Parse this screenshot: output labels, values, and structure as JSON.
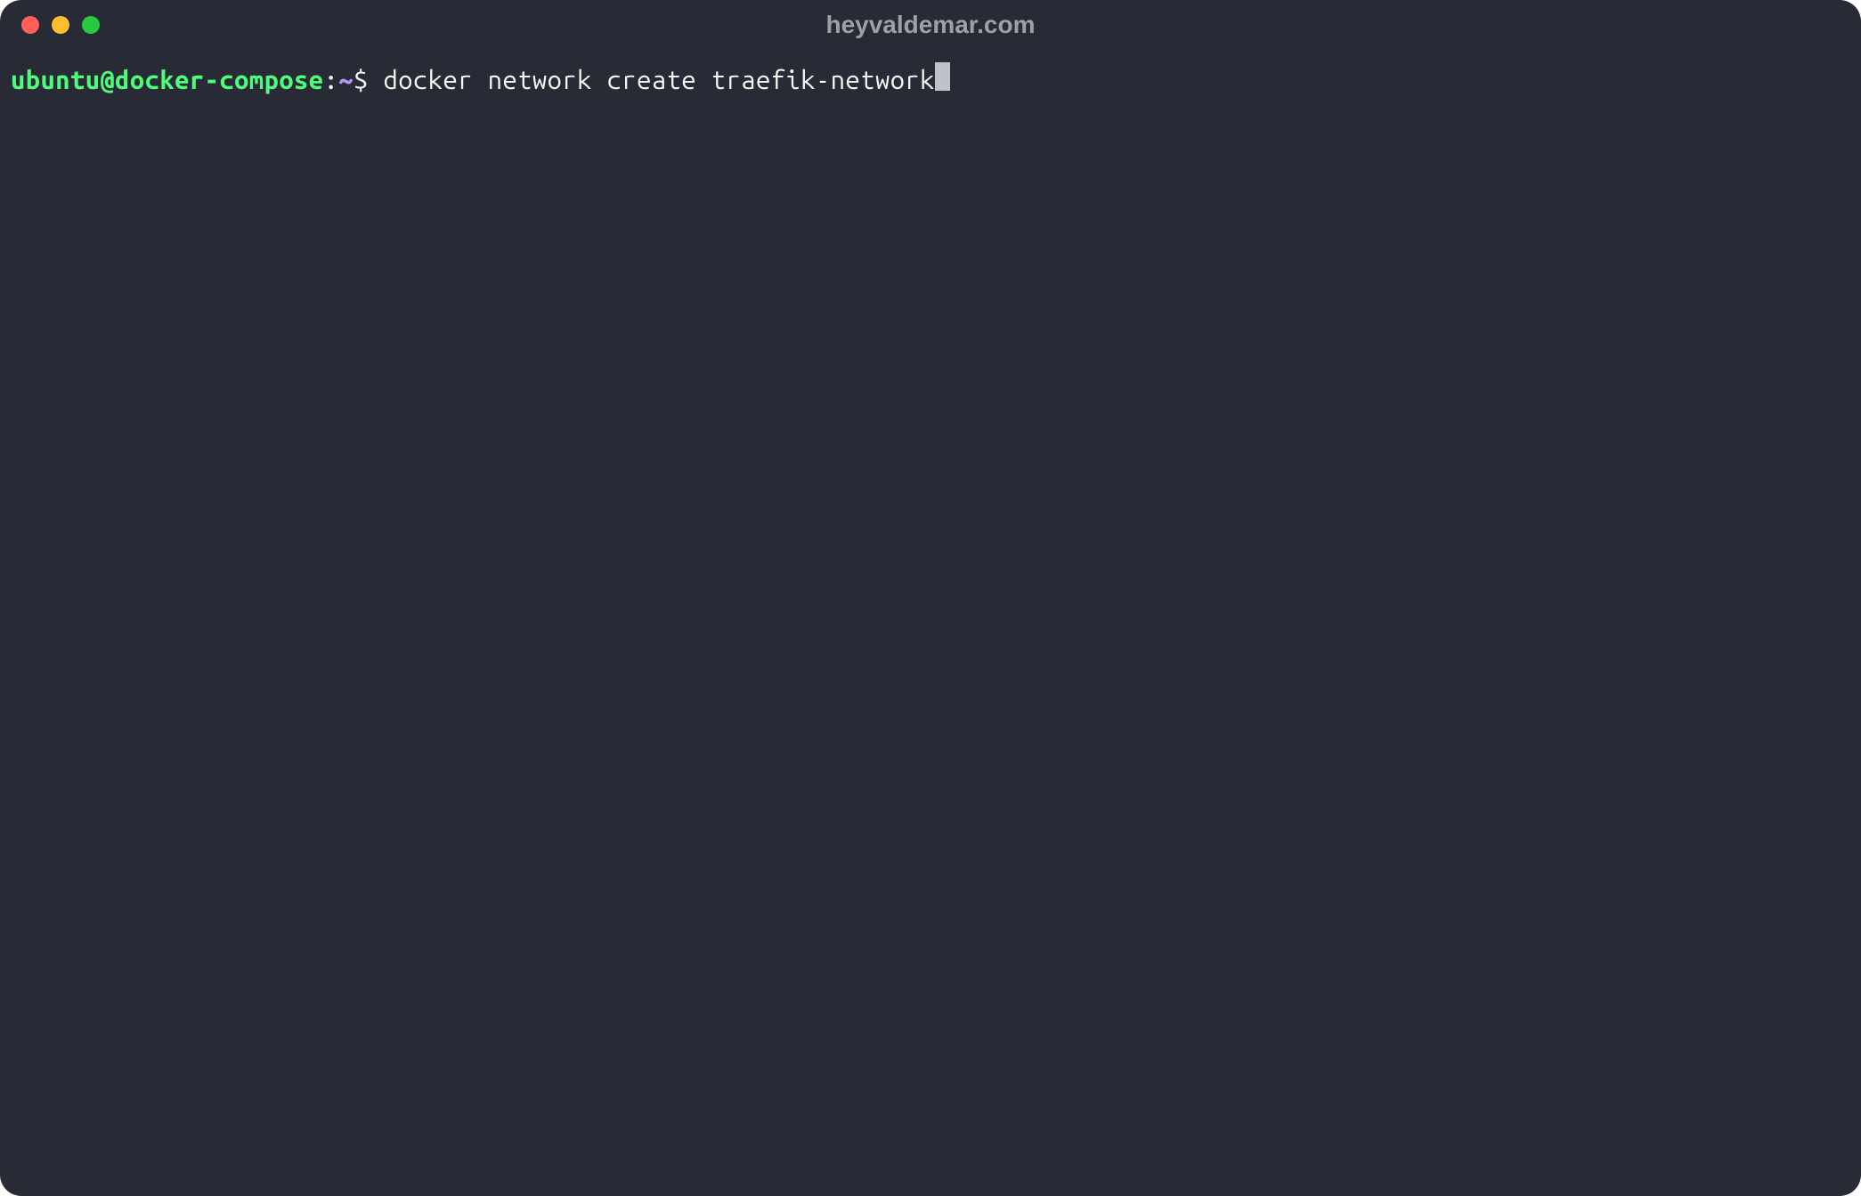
{
  "window": {
    "title": "heyvaldemar.com"
  },
  "prompt": {
    "user_host": "ubuntu@docker-compose",
    "separator": ":",
    "path": "~",
    "symbol": "$ "
  },
  "command": "docker network create traefik-network",
  "colors": {
    "background": "#282a36",
    "prompt_green": "#50fa7b",
    "prompt_purple": "#bd93f9",
    "text": "#f8f8f2",
    "title": "#9da0a8",
    "close": "#ff5f57",
    "minimize": "#febc2e",
    "maximize": "#28c840"
  }
}
